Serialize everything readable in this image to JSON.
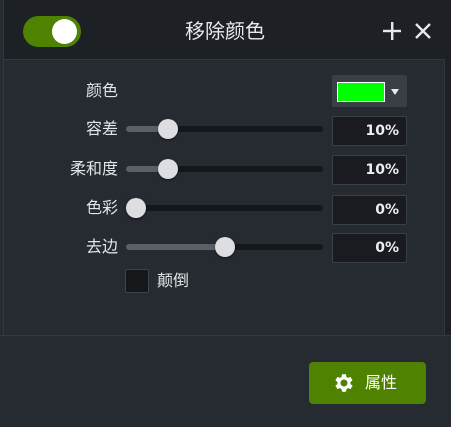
{
  "header": {
    "title": "移除颜色",
    "enabled": true,
    "add_icon": "plus-icon",
    "close_icon": "close-icon"
  },
  "colors": {
    "accent": "#4f8200",
    "selected_color": "#00ff00"
  },
  "rows": {
    "color_label": "颜色",
    "tolerance": {
      "label": "容差",
      "value": 10,
      "display": "10%"
    },
    "softness": {
      "label": "柔和度",
      "value": 10,
      "display": "10%"
    },
    "hue": {
      "label": "色彩",
      "value": 0,
      "display": "0%"
    },
    "defringe": {
      "label": "去边",
      "value": 50,
      "display": "0%"
    }
  },
  "invert": {
    "label": "颠倒",
    "checked": false
  },
  "footer": {
    "properties_label": "属性",
    "properties_icon": "gear-icon"
  }
}
